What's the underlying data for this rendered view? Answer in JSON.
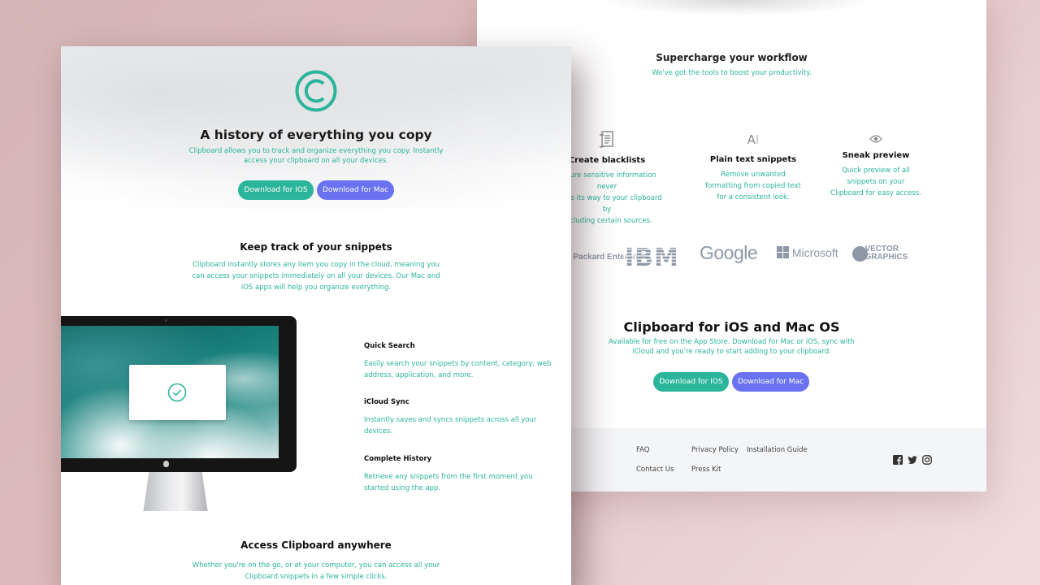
{
  "back": {
    "section_title": "Supercharge your workflow",
    "section_subtitle": "We've got the tools to boost your productivity.",
    "features": [
      {
        "icon": "blacklist-icon",
        "name": "Create blacklists",
        "desc_lines": [
          "Ensure sensitive information never",
          "makes its way to your clipboard by",
          "excluding certain sources."
        ]
      },
      {
        "icon": "text-icon",
        "name": "Plain text snippets",
        "desc_lines": [
          "Remove unwanted",
          "formatting from copied text",
          "for a consistent look."
        ]
      },
      {
        "icon": "eye-icon",
        "name": "Sneak preview",
        "desc_lines": [
          "Quick preview of all",
          "snippets on your",
          "Clipboard for easy access."
        ]
      }
    ],
    "logos": [
      "Hewlett Packard Enterprise",
      "IBM",
      "Google",
      "Microsoft",
      "VECTOR GRAPHICS"
    ],
    "cta_title": "Clipboard for iOS and Mac OS",
    "cta_sub_lines": [
      "Available for free on the App Store. Download for Mac or iOS, sync with",
      "iCloud and you're ready to start adding to your clipboard."
    ],
    "btn_ios": "Download for IOS",
    "btn_mac": "Download for Mac",
    "footer": {
      "links": [
        "FAQ",
        "Contact Us",
        "Privacy Policy",
        "Press Kit",
        "Installation Guide"
      ],
      "social": [
        "facebook-icon",
        "twitter-icon",
        "instagram-icon"
      ]
    }
  },
  "front": {
    "logo": "clipboard-logo-icon",
    "title": "A history of everything you copy",
    "subtitle_lines": [
      "Clipboard allows you to track and organize everything you copy. Instantly",
      "access your clipboard on all your devices."
    ],
    "btn_ios": "Download for IOS",
    "btn_mac": "Download for Mac",
    "snippets_title": "Keep track of your snippets",
    "snippets_lines": [
      "Clipboard instantly stores any item you copy in the cloud, meaning you",
      "can access your snippets immediately on all your devices. Our Mac and",
      "iOS apps will help you organize everything."
    ],
    "features": [
      {
        "name": "Quick Search",
        "desc_lines": [
          "Easily search your snippets by content, category, web",
          "address, application, and more."
        ]
      },
      {
        "name": "iCloud Sync",
        "desc_lines": [
          "Instantly saves and syncs snippets across all your",
          "devices."
        ]
      },
      {
        "name": "Complete History",
        "desc_lines": [
          "Retrieve any snippets from the first moment you",
          "started using the app."
        ]
      }
    ],
    "access_title": "Access Clipboard anywhere",
    "access_lines": [
      "Whether you're on the go, or at your computer, you can access all your",
      "Clipboard snippets in a few simple clicks."
    ]
  },
  "colors": {
    "teal": "#2bb59a",
    "blue": "#6a72f1",
    "background": "#d6b5b7"
  }
}
